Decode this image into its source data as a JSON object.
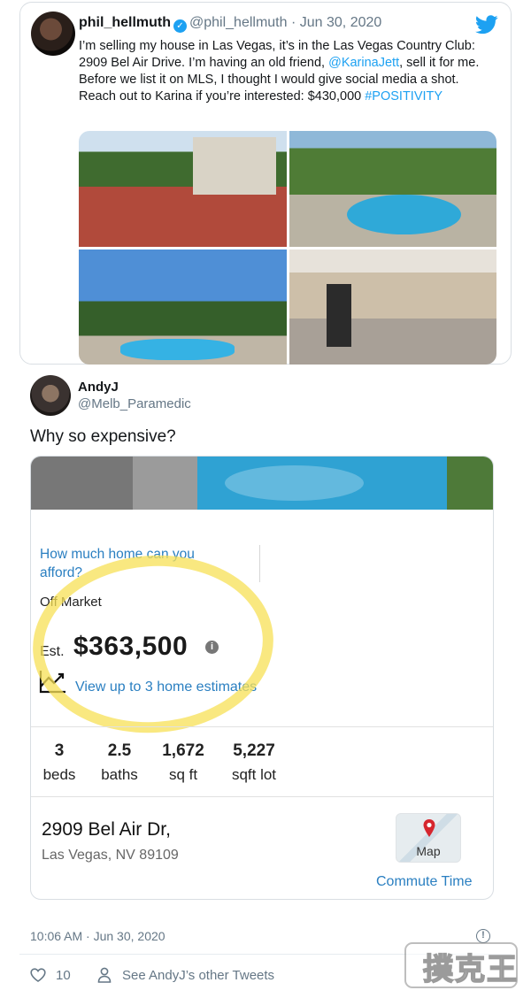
{
  "quoted_tweet": {
    "name": "phil_hellmuth",
    "handle": "@phil_hellmuth",
    "date": "· Jun 30, 2020",
    "text_1": "I’m selling my house in Las Vegas, it’s in the Las Vegas Country Club: 2909 Bel Air Drive. I’m having an old friend, ",
    "mention": "@KarinaJett",
    "text_2": ", sell it for me. Before we list it on MLS, I thought I would give social media a shot. Reach out to Karina if you’re interested: $430,000 ",
    "hashtag": "#POSITIVITY",
    "verified_glyph": "✓"
  },
  "reply": {
    "name": "AndyJ",
    "handle": "@Melb_Paramedic",
    "text": "Why so expensive?"
  },
  "listing": {
    "afford_link": "How much home can you afford?",
    "status": "Off Market",
    "est_label": "Est.",
    "est_value": "$363,500",
    "info_glyph": "i",
    "estimates_link": "View up to 3 home estimates",
    "stats": [
      {
        "num": "3",
        "label": "beds"
      },
      {
        "num": "2.5",
        "label": "baths"
      },
      {
        "num": "1,672",
        "label": "sq ft"
      },
      {
        "num": "5,227",
        "label": "sqft lot"
      }
    ],
    "address_line1": "2909 Bel Air Dr,",
    "address_line2": "Las Vegas, NV 89109",
    "map_label": "Map",
    "commute_link": "Commute Time"
  },
  "footer": {
    "timestamp": "10:06 AM · Jun 30, 2020",
    "help_glyph": "!",
    "likes": "10",
    "others_link": "See AndyJ’s other Tweets"
  },
  "watermark": {
    "text": "撲克王"
  },
  "colors": {
    "twitter_blue": "#1da1f2",
    "link_blue": "#2a7fc1",
    "highlight_yellow": "#f7e056",
    "cta_red": "#d6262e"
  }
}
